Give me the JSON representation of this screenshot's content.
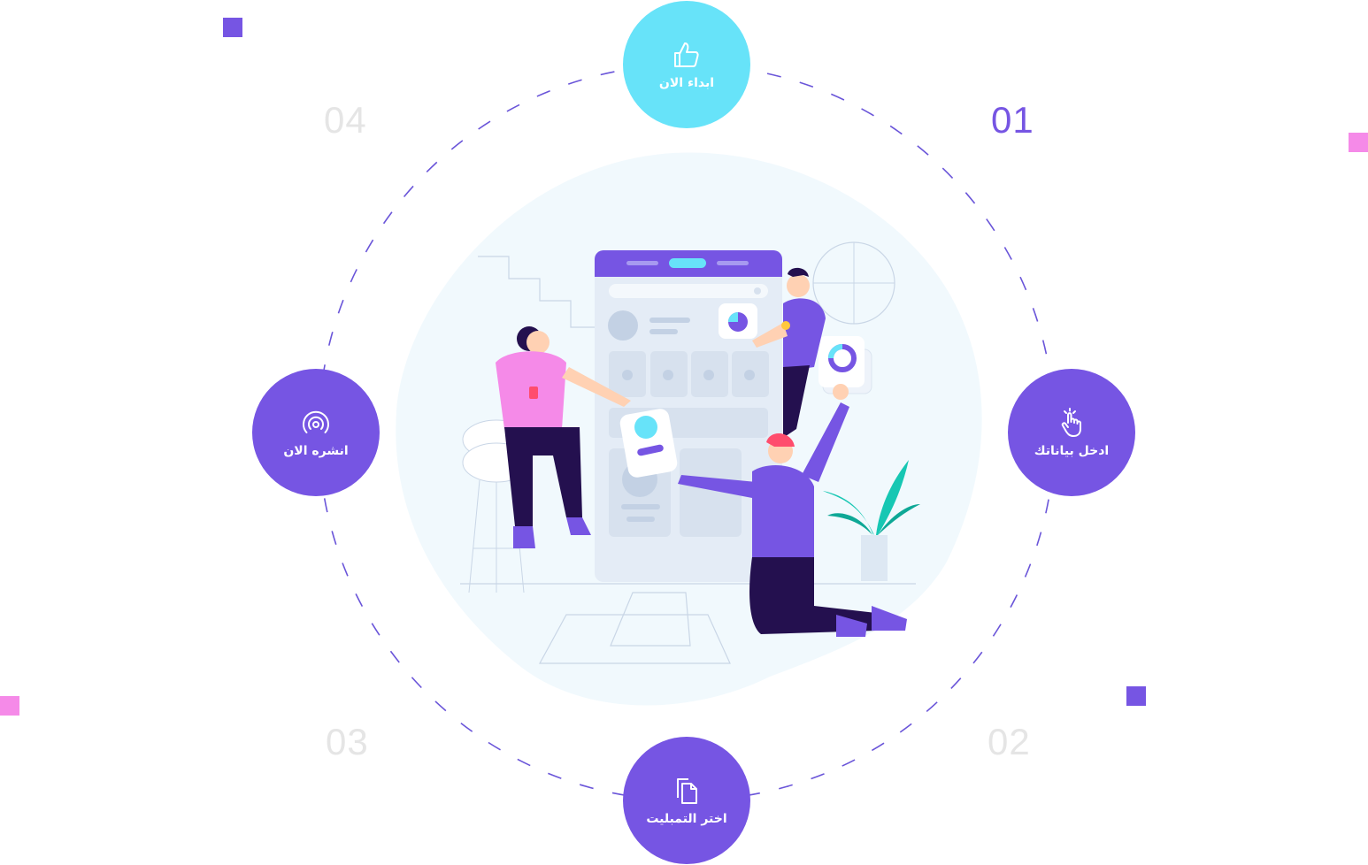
{
  "colors": {
    "primary": "#7655e3",
    "cyan": "#67e3f9",
    "pink": "#f58ae8",
    "number_active": "#7655e3",
    "number_inactive": "#e5e5e5",
    "dash": "#6a55d9"
  },
  "steps": [
    {
      "number": "01",
      "label": "ابداء الان",
      "icon": "thumbs-up-icon"
    },
    {
      "number": "",
      "label": "ادخل بياناتك",
      "icon": "tap-hand-icon"
    },
    {
      "number": "02",
      "label": "اختر التمبليت",
      "icon": "copy-document-icon"
    },
    {
      "number": "03",
      "label": "انشره الان",
      "icon": "broadcast-icon"
    }
  ],
  "numbers": {
    "n01": "01",
    "n02": "02",
    "n03": "03",
    "n04": "04"
  }
}
